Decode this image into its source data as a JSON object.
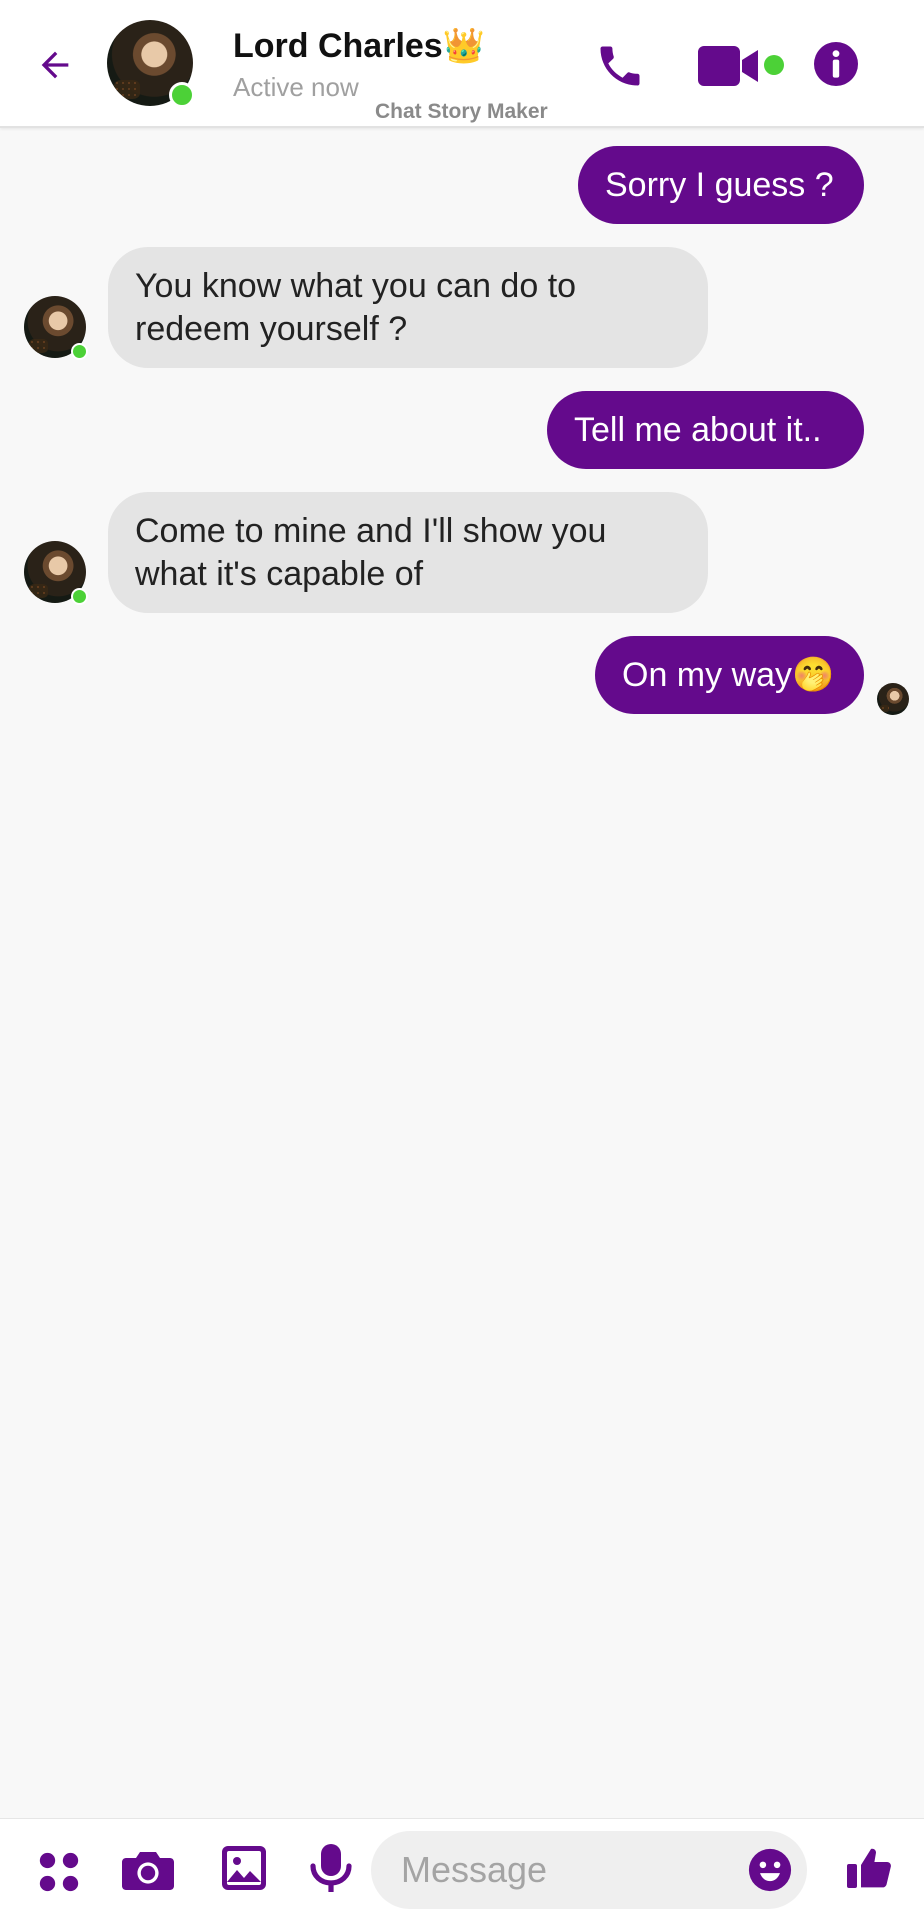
{
  "colors": {
    "accent": "#640a8c",
    "online": "#4cd137",
    "incoming_bubble": "#e4e4e4",
    "background": "#f8f8f8"
  },
  "header": {
    "contact_name": "Lord Charles👑",
    "status": "Active now",
    "watermark": "Chat Story Maker",
    "icons": [
      "back-arrow-icon",
      "phone-icon",
      "video-camera-icon",
      "info-icon"
    ]
  },
  "messages": [
    {
      "direction": "out",
      "text": "Sorry I guess ?"
    },
    {
      "direction": "in",
      "text": "You know what you can do to redeem yourself ?"
    },
    {
      "direction": "out",
      "text": "Tell me about it.."
    },
    {
      "direction": "in",
      "text": "Come to mine and I'll show you what it's capable of"
    },
    {
      "direction": "out",
      "text": "On my way🤭"
    }
  ],
  "composer": {
    "placeholder": "Message",
    "value": "",
    "icons": [
      "menu-dots-icon",
      "camera-icon",
      "image-icon",
      "microphone-icon",
      "emoji-icon",
      "thumbs-up-icon"
    ]
  }
}
